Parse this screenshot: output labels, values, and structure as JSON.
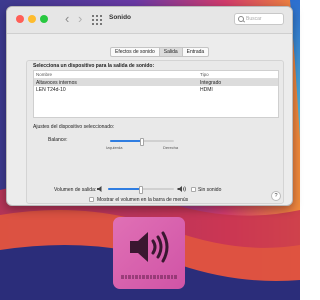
{
  "colors": {
    "accent": "#2f7de1",
    "hud_bg": "#d75aa9"
  },
  "window": {
    "title": "Sonido",
    "nav_back": "‹",
    "nav_forward": "›",
    "grid_icon": "show-all-icon"
  },
  "search": {
    "placeholder": "Buscar"
  },
  "tabs": [
    {
      "label": "Efectos de sonido",
      "active": false
    },
    {
      "label": "Salida",
      "active": true
    },
    {
      "label": "Entrada",
      "active": false
    }
  ],
  "output": {
    "heading": "Selecciona un dispositivo para la salida de sonido:",
    "columns": [
      "Nombre",
      "Tipo"
    ],
    "devices": [
      {
        "name": "Altavoces internos",
        "type": "Integrado",
        "selected": true
      },
      {
        "name": "LEN T24d-10",
        "type": "HDMI",
        "selected": false
      }
    ]
  },
  "settings": {
    "heading": "Ajustes del dispositivo seleccionado:",
    "balance_label": "Balance:",
    "left_label": "Izquierda",
    "right_label": "Derecha",
    "balance_value": 0.5,
    "help_label": "?"
  },
  "volume": {
    "label": "Volumen de salida:",
    "level": 0.5,
    "mute_label": "Sin sonido",
    "mute_checked": false,
    "show_in_menubar_label": "Mostrar el volumen en la barra de menús",
    "show_in_menubar_checked": false
  },
  "hud": {
    "icon": "speaker-volume-icon",
    "segments": 16,
    "filled": 0
  }
}
